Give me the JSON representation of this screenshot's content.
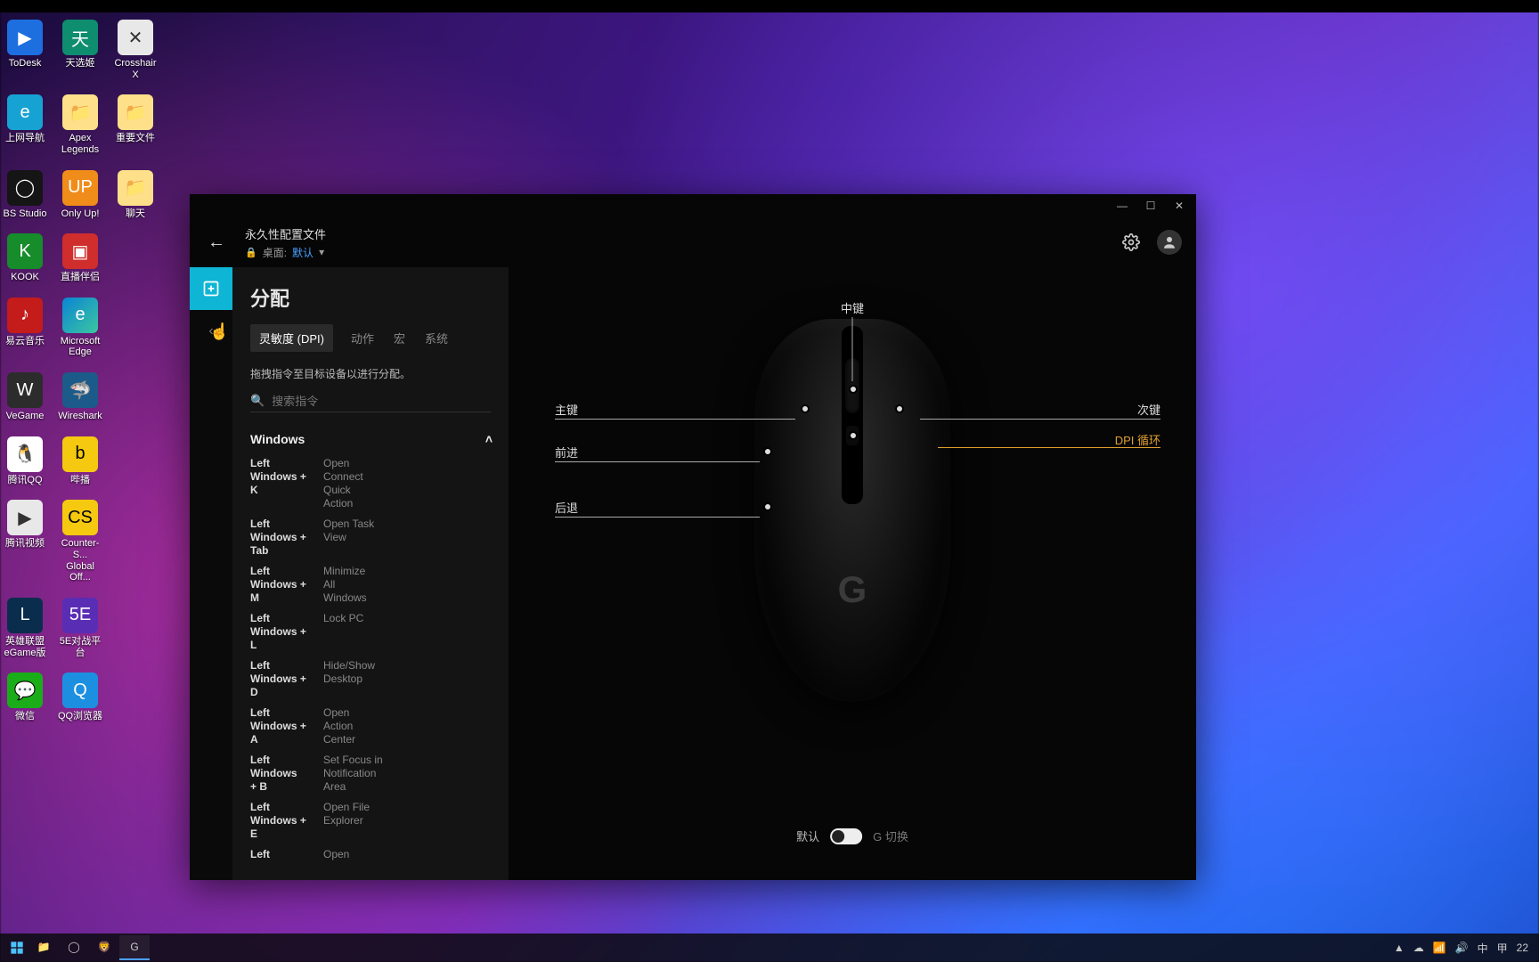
{
  "desktop_icons": {
    "row0": [
      "ToDesk",
      "天选姬",
      "Crosshair X"
    ],
    "row1": [
      "上网导航",
      "Apex\nLegends",
      "重要文件"
    ],
    "row2": [
      "BS Studio",
      "Only Up!",
      "聊天"
    ],
    "row3": [
      "KOOK",
      "直播伴侣"
    ],
    "row4": [
      "易云音乐",
      "Microsoft\nEdge"
    ],
    "row5": [
      "VeGame",
      "Wireshark"
    ],
    "row6": [
      "腾讯QQ",
      "哔播"
    ],
    "row7": [
      "腾讯视频",
      "Counter-S...\nGlobal Off..."
    ],
    "row8": [
      "英雄联盟\nеGame版",
      "5E对战平台"
    ],
    "row9": [
      "微信",
      "QQ浏览器"
    ]
  },
  "app": {
    "header": {
      "title": "永久性配置文件",
      "lock_text": "桌面:",
      "profile": "默认"
    },
    "side": {
      "title": "分配",
      "tabs": [
        "灵敏度 (DPI)",
        "动作",
        "宏",
        "系统"
      ],
      "active_tab": 0,
      "hint": "拖拽指令至目标设备以进行分配。",
      "search_placeholder": "搜索指令",
      "section": "Windows",
      "commands": [
        {
          "k": "Left\nWindows +\nK",
          "d": "Open\nConnect\nQuick\nAction"
        },
        {
          "k": "Left\nWindows +\nTab",
          "d": "Open Task\nView"
        },
        {
          "k": "Left\nWindows +\nM",
          "d": "Minimize\nAll\nWindows"
        },
        {
          "k": "Left\nWindows +\nL",
          "d": "Lock PC"
        },
        {
          "k": "Left\nWindows +\nD",
          "d": "Hide/Show\nDesktop"
        },
        {
          "k": "Left\nWindows +\nA",
          "d": "Open\nAction\nCenter"
        },
        {
          "k": "Left\nWindows\n+ B",
          "d": "Set Focus in\nNotification\nArea"
        },
        {
          "k": "Left\nWindows +\nE",
          "d": "Open File\nExplorer"
        },
        {
          "k": "Left",
          "d": "Open"
        }
      ]
    },
    "mouse_labels": {
      "middle": "中键",
      "primary": "主键",
      "secondary": "次键",
      "forward": "前进",
      "back": "后退",
      "dpi": "DPI 循环"
    },
    "toggle": {
      "left": "默认",
      "right": "G 切换"
    }
  },
  "taskbar": {
    "tray": [
      "▲",
      "☁",
      "🔊",
      "中",
      "甲"
    ],
    "time_hint": "22"
  }
}
